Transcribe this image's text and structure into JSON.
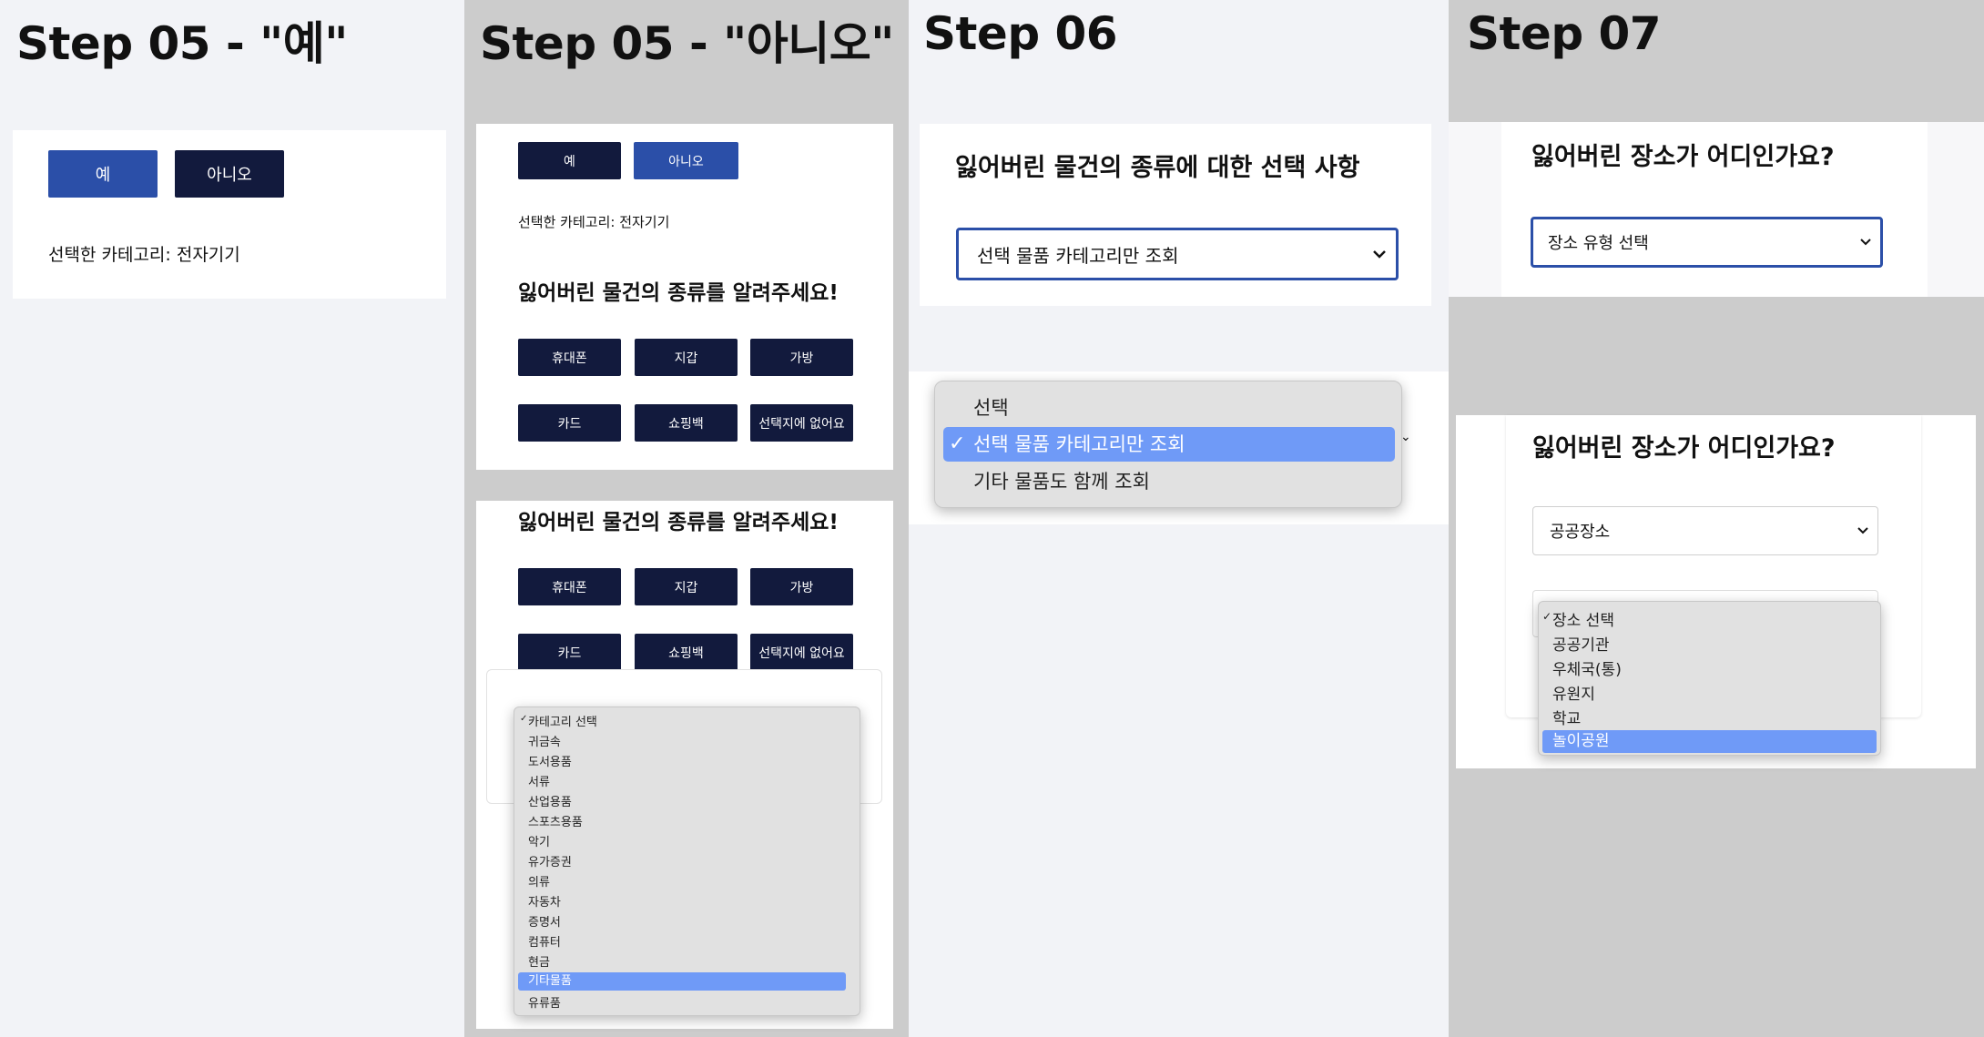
{
  "step5_yes": {
    "title": "Step 05 - \"예\"",
    "yes_button": "예",
    "no_button": "아니오",
    "selected_text": "선택한 카테고리: 전자기기"
  },
  "step5_no": {
    "title": "Step 05 - \"아니오\"",
    "yes_button": "예",
    "no_button": "아니오",
    "selected_text": "선택한 카테고리: 전자기기",
    "question": "잃어버린 물건의 종류를 알려주세요!",
    "category_buttons": [
      "휴대폰",
      "지갑",
      "가방",
      "카드",
      "쇼핑백",
      "선택지에 없어요"
    ],
    "dropdown_options": [
      "카테고리 선택",
      "귀금속",
      "도서용품",
      "서류",
      "산업용품",
      "스포츠용품",
      "악기",
      "유가증권",
      "의류",
      "자동차",
      "증명서",
      "컴퓨터",
      "현금",
      "기타물품",
      "유류품"
    ],
    "dropdown_checked": "카테고리 선택",
    "dropdown_highlighted": "기타물품"
  },
  "step6": {
    "title": "Step 06",
    "heading": "잃어버린 물건의 종류에 대한 선택 사항",
    "select_value": "선택 물품 카테고리만 조회",
    "options": [
      "선택",
      "선택 물품 카테고리만 조회",
      "기타 물품도 함께 조회"
    ],
    "highlighted": "선택 물품 카테고리만 조회"
  },
  "step7": {
    "title": "Step 07",
    "heading": "잃어버린 장소가 어디인가요?",
    "select_placeholder": "장소 유형 선택",
    "select_value": "공공장소",
    "options": [
      "장소 선택",
      "공공기관",
      "우체국(통)",
      "유원지",
      "학교",
      "놀이공원"
    ],
    "checked": "장소 선택",
    "highlighted": "놀이공원"
  },
  "colors": {
    "navy": "#121a3d",
    "blue": "#2b4fa8",
    "highlight": "#6f9af7"
  }
}
